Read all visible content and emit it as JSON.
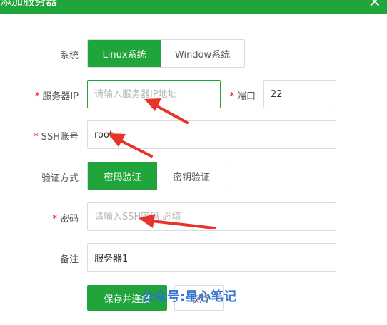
{
  "dialog": {
    "title": "添加服务器",
    "close_icon": "×"
  },
  "form": {
    "system_label": "系统",
    "system_options": [
      "Linux系统",
      "Window系统"
    ],
    "server_ip_label": "服务器IP",
    "server_ip_placeholder": "请输入服务器IP地址",
    "port_label": "端口",
    "port_value": "22",
    "ssh_account_label": "SSH账号",
    "ssh_account_value": "root",
    "auth_method_label": "验证方式",
    "auth_options": [
      "密码验证",
      "密钥验证"
    ],
    "password_label": "密码",
    "password_placeholder": "请输入SSH密码,必填",
    "remark_label": "备注",
    "remark_value": "服务器1",
    "required_mark": "*"
  },
  "buttons": {
    "save_label": "保存并连接",
    "cancel_label": "取消"
  },
  "watermark": "公众号:星心笔记",
  "colors": {
    "accent": "#20a53a",
    "arrow": "#e8322a",
    "required": "#ef0808",
    "watermark": "#2f6fd8"
  }
}
